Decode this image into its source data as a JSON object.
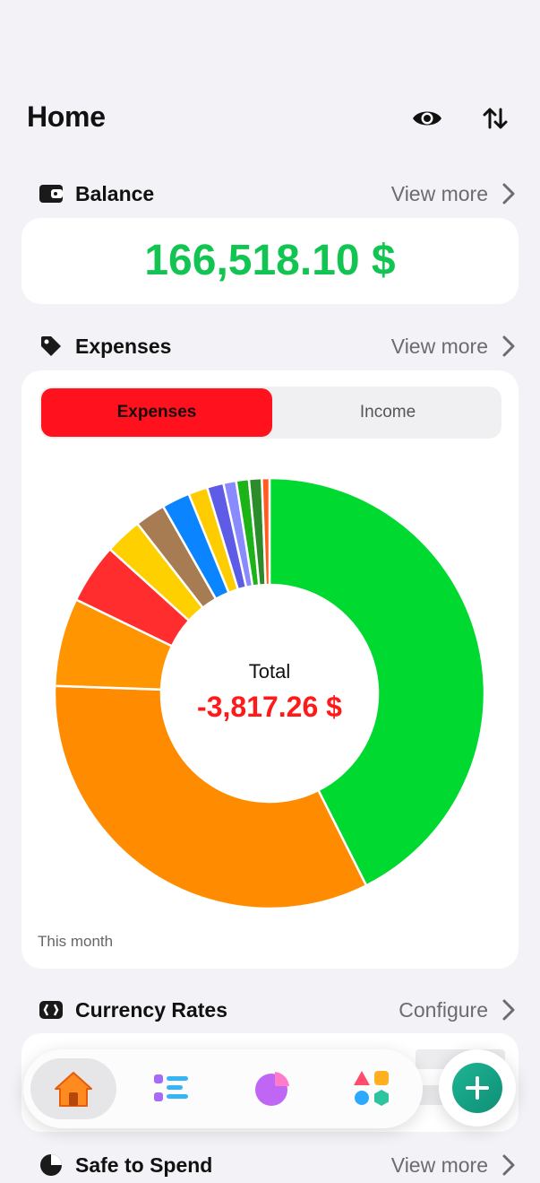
{
  "header": {
    "title": "Home"
  },
  "balance": {
    "label": "Balance",
    "view_more": "View more",
    "amount": "166,518.10 $"
  },
  "expenses": {
    "label": "Expenses",
    "view_more": "View more",
    "tabs": {
      "active": "Expenses",
      "inactive": "Income"
    },
    "total_label": "Total",
    "total_value": "-3,817.26 $",
    "period": "This month"
  },
  "chart_data": {
    "type": "pie",
    "title": "",
    "categories": [
      "",
      "",
      "",
      "",
      "",
      "",
      "",
      "",
      "",
      "",
      "",
      "",
      ""
    ],
    "values": [
      44.4,
      34.4,
      6.9,
      4.7,
      2.9,
      2.4,
      2.2,
      1.5,
      1.3,
      1.0,
      1.0,
      1.0,
      0.6
    ],
    "colors": [
      "#00d92f",
      "#ff8c00",
      "#ff9500",
      "#ff2d2d",
      "#ffd000",
      "#a87c53",
      "#0a84ff",
      "#ffcc00",
      "#5e5ce6",
      "#8a8aff",
      "#1bb317",
      "#2c8c2c",
      "#ff5a1f"
    ],
    "total_text": "-3,817.26 $"
  },
  "currency": {
    "label": "Currency Rates",
    "configure": "Configure"
  },
  "safe_to_spend": {
    "label": "Safe to Spend",
    "view_more": "View more"
  },
  "colors": {
    "accent_green": "#12c452",
    "expense_red": "#ff111e",
    "fab_green": "#1aa88a"
  },
  "tabbar": {
    "items": [
      "home-icon",
      "list-icon",
      "chart-icon",
      "categories-icon"
    ]
  },
  "fab": {
    "icon": "plus-icon"
  }
}
